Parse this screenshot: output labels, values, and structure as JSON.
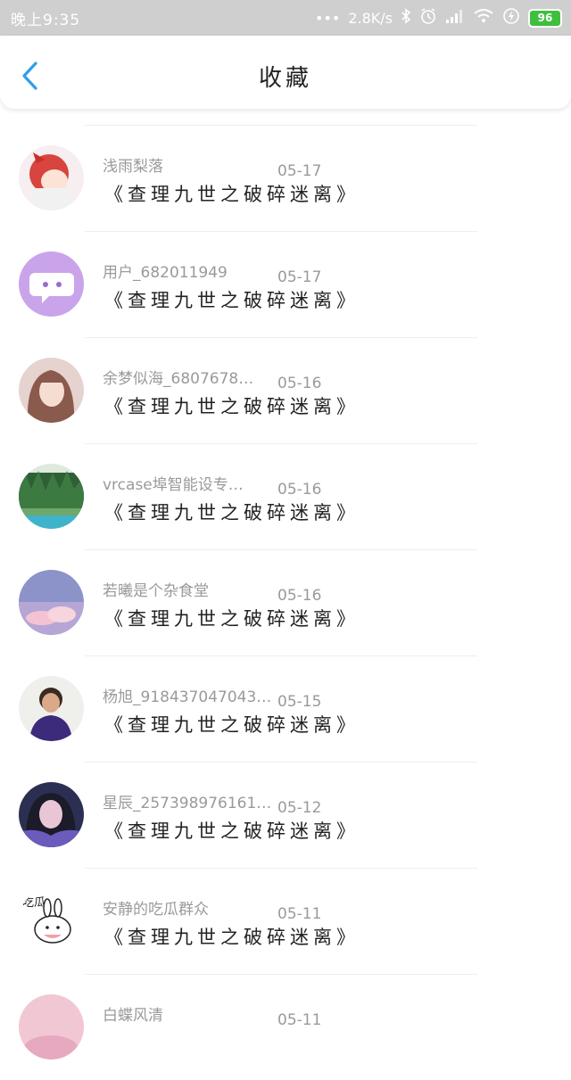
{
  "status_bar": {
    "time": "晚上9:35",
    "dots": "•••",
    "network_speed": "2.8K/s",
    "battery": "96",
    "icons": [
      "bluetooth-icon",
      "alarm-icon",
      "signal-icon",
      "wifi-icon",
      "charging-icon",
      "battery-icon"
    ]
  },
  "header": {
    "title": "收藏",
    "back_icon": "chevron-left-icon"
  },
  "colors": {
    "accent": "#2f9ee8",
    "status_bar": "#cfcfcf",
    "battery": "#3fbf3f"
  },
  "items": [
    {
      "user": "浅雨梨落",
      "date": "05-17",
      "post": "《查理九世之破碎迷离》"
    },
    {
      "user": "用户_682011949",
      "date": "05-17",
      "post": "《查理九世之破碎迷离》"
    },
    {
      "user": "余梦似海_6807678…",
      "date": "05-16",
      "post": "《查理九世之破碎迷离》"
    },
    {
      "user": "vrcase埠智能设专…",
      "date": "05-16",
      "post": "《查理九世之破碎迷离》"
    },
    {
      "user": "若曦是个杂食堂",
      "date": "05-16",
      "post": "《查理九世之破碎迷离》"
    },
    {
      "user": "杨旭_918437047043…",
      "date": "05-15",
      "post": "《查理九世之破碎迷离》"
    },
    {
      "user": "星辰_257398976161…",
      "date": "05-12",
      "post": "《查理九世之破碎迷离》"
    },
    {
      "user": "安静的吃瓜群众",
      "date": "05-11",
      "post": "《查理九世之破碎迷离》",
      "avatar_text": "吃瓜"
    },
    {
      "user": "白蝶风清",
      "date": "05-11",
      "post": ""
    }
  ]
}
